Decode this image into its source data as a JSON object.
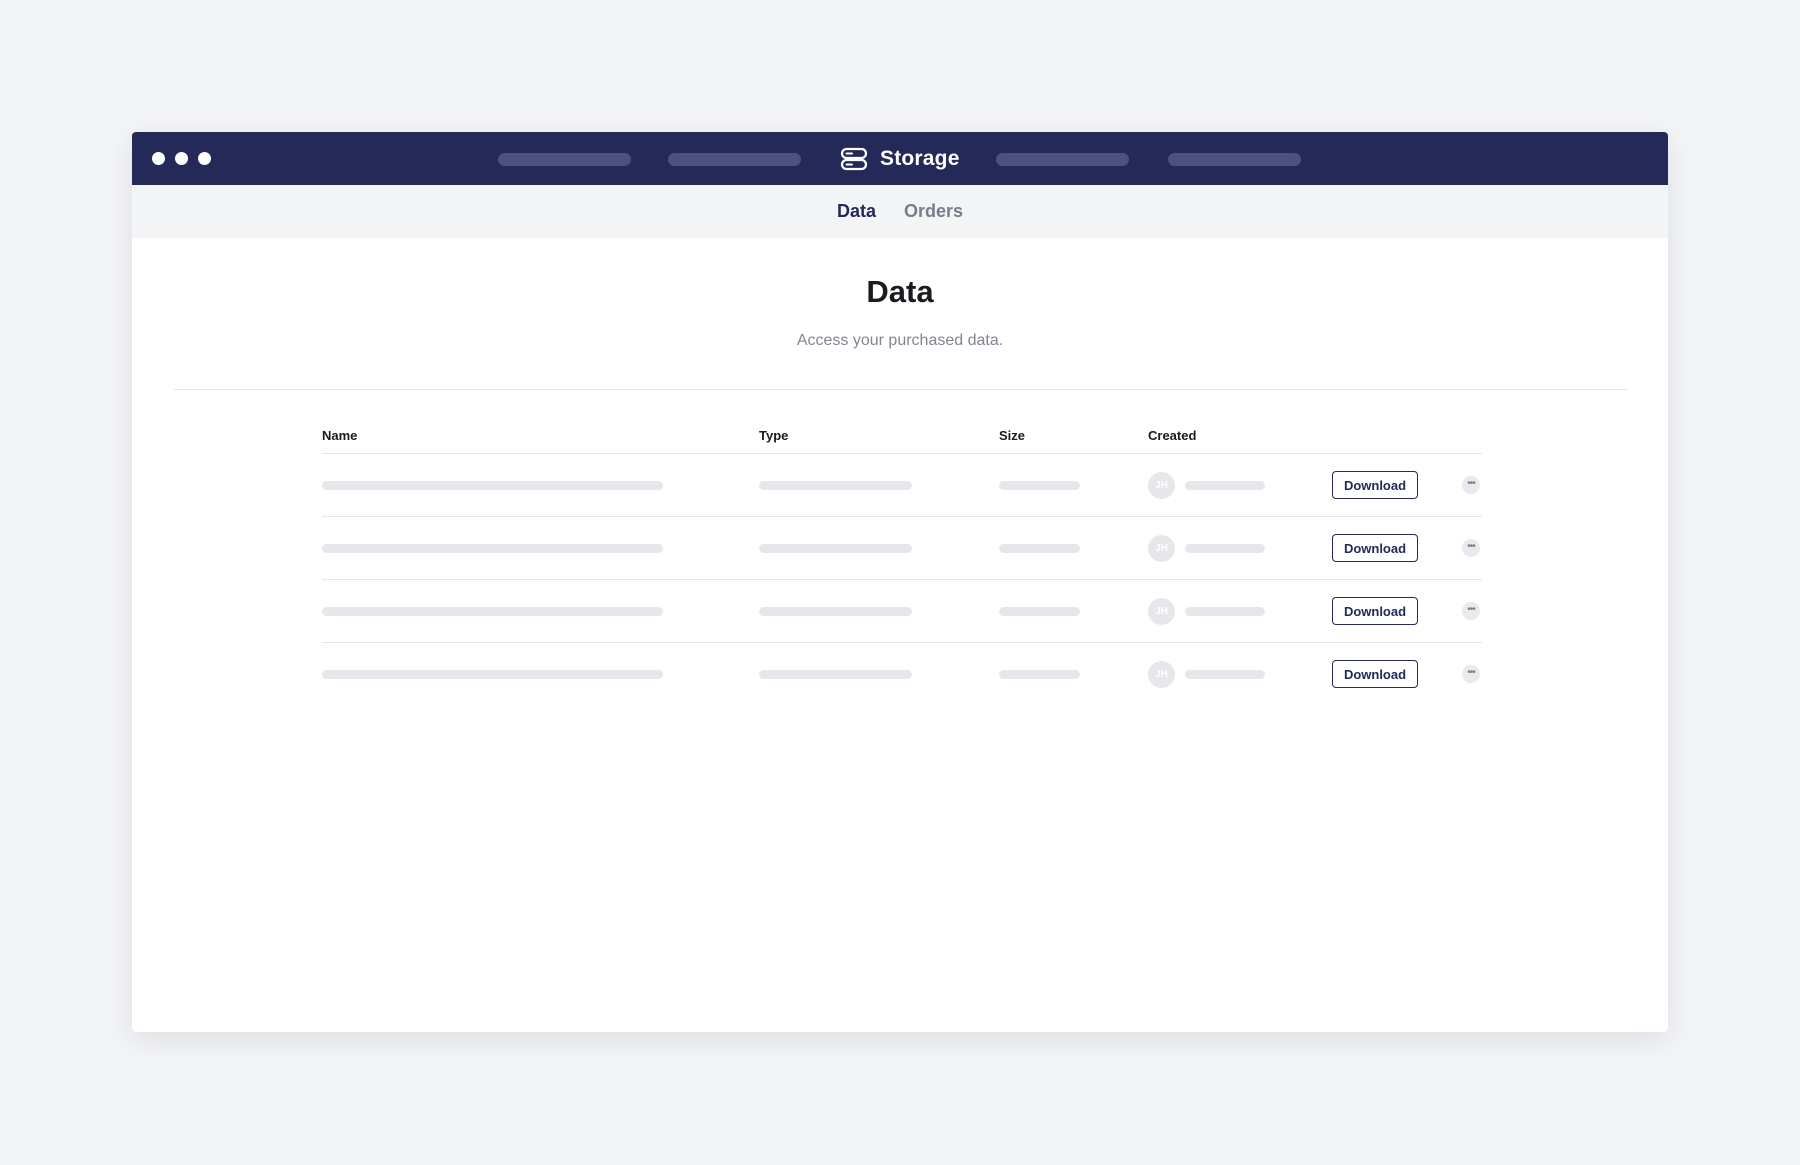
{
  "app": {
    "title": "Storage",
    "icon": "storage-icon",
    "nav_placeholder_count": 4
  },
  "subnav": {
    "tabs": [
      {
        "label": "Data",
        "active": true
      },
      {
        "label": "Orders",
        "active": false
      }
    ]
  },
  "page": {
    "title": "Data",
    "subtitle": "Access your purchased data."
  },
  "table": {
    "columns": [
      "Name",
      "Type",
      "Size",
      "Created"
    ],
    "rows": [
      {
        "avatar_initials": "JH",
        "download_label": "Download",
        "more_icon": "ellipsis-icon"
      },
      {
        "avatar_initials": "JH",
        "download_label": "Download",
        "more_icon": "ellipsis-icon"
      },
      {
        "avatar_initials": "JH",
        "download_label": "Download",
        "more_icon": "ellipsis-icon"
      },
      {
        "avatar_initials": "JH",
        "download_label": "Download",
        "more_icon": "ellipsis-icon"
      }
    ]
  },
  "colors": {
    "titlebar": "#242958",
    "accent": "#242958",
    "placeholder_nav": "#4b5282",
    "placeholder_content": "#e6e7eb",
    "page_background": "#f3f4f6"
  }
}
